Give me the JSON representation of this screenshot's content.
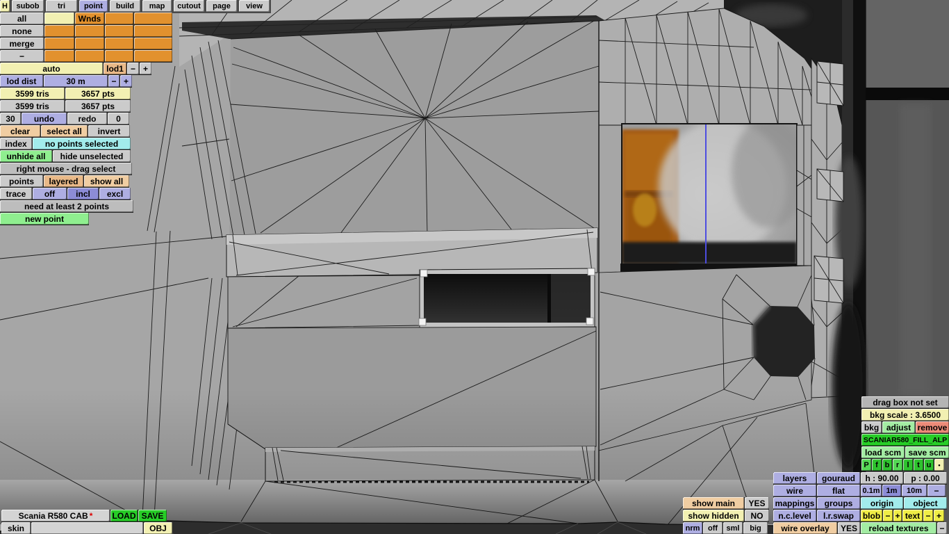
{
  "menu": {
    "items": [
      "H",
      "subob",
      "tri",
      "point",
      "build",
      "map",
      "cutout",
      "page",
      "view"
    ],
    "active": "point"
  },
  "subob_grid": {
    "side": [
      "all",
      "none",
      "merge",
      "−"
    ],
    "wnds": "Wnds"
  },
  "lod": {
    "auto": "auto",
    "lod1": "lod1",
    "minus": "−",
    "plus": "+",
    "dist_label": "lod dist",
    "dist_value": "30 m",
    "dist_minus": "−",
    "dist_plus": "+",
    "tris_current": "3599 tris",
    "pts_current": "3657 pts",
    "tris_total": "3599 tris",
    "pts_total": "3657 pts"
  },
  "history": {
    "undo_steps": "30",
    "undo_label": "undo",
    "redo_label": "redo",
    "redo_steps": "0"
  },
  "selection": {
    "clear": "clear",
    "select_all": "select all",
    "invert": "invert",
    "index": "index",
    "status": "no points selected",
    "unhide_all": "unhide all",
    "hide_unselected": "hide unselected",
    "drag_hint": "right mouse - drag select",
    "points": "points",
    "layered": "layered",
    "show_all": "show all",
    "trace": "trace",
    "trace_off": "off",
    "trace_incl": "incl",
    "trace_excl": "excl",
    "warning": "need at least 2 points",
    "new_point": "new point"
  },
  "file_bar": {
    "model_name": "Scania R580 CAB",
    "modified": "*",
    "load": "LOAD",
    "save": "SAVE",
    "skin_label": "skin",
    "skin_value": "",
    "obj": "OBJ"
  },
  "bkg_panel": {
    "drag_box_status": "drag box not set",
    "scale": "bkg scale : 3.6500",
    "bkg": "bkg",
    "adjust": "adjust",
    "remove": "remove",
    "texture_name": "SCANIAR580_FILL_ALP",
    "load_scm": "load scm",
    "save_scm": "save scm",
    "view_buttons": [
      "P",
      "f",
      "b",
      "r",
      "l",
      "t",
      "u",
      "•"
    ]
  },
  "display_panel": {
    "layers": "layers",
    "shading_gouraud": "gouraud",
    "heading": "h : 90.00",
    "pitch": "p : 0.00",
    "wire": "wire",
    "shading_flat": "flat",
    "grid_01m": "0.1m",
    "grid_1m": "1m",
    "grid_10m": "10m",
    "grid_minus": "−",
    "show_main": "show main",
    "show_main_value": "YES",
    "mappings": "mappings",
    "groups": "groups",
    "origin": "origin",
    "object": "object",
    "show_hidden": "show hidden",
    "show_hidden_value": "NO",
    "nc_level": "n.c.level",
    "lr_swap": "l.r.swap",
    "blob": "blob",
    "blob_minus": "−",
    "blob_plus": "+",
    "text_label": "text",
    "text_minus": "−",
    "text_plus": "+",
    "nrm": "nrm",
    "nrm_off": "off",
    "nrm_sml": "sml",
    "nrm_big": "big",
    "wire_overlay": "wire overlay",
    "wire_overlay_value": "YES",
    "reload_textures": "reload textures",
    "reload_minus": "−"
  },
  "colors": {
    "periwinkle": "#aeaee2",
    "periwinkle_active": "#8c8cd6",
    "orange_cell": "#e2912e",
    "bright_green": "#27cd27",
    "light_green": "#a3eca3",
    "salmon": "#ec8a78",
    "cyan": "#a2ecec",
    "cream": "#f2f0b2",
    "yellow": "#efed46",
    "tan": "#e9b988",
    "peach": "#f0cda2",
    "selection_handle": "#f3f3f3",
    "guide_line_blue": "#4d4de0"
  }
}
